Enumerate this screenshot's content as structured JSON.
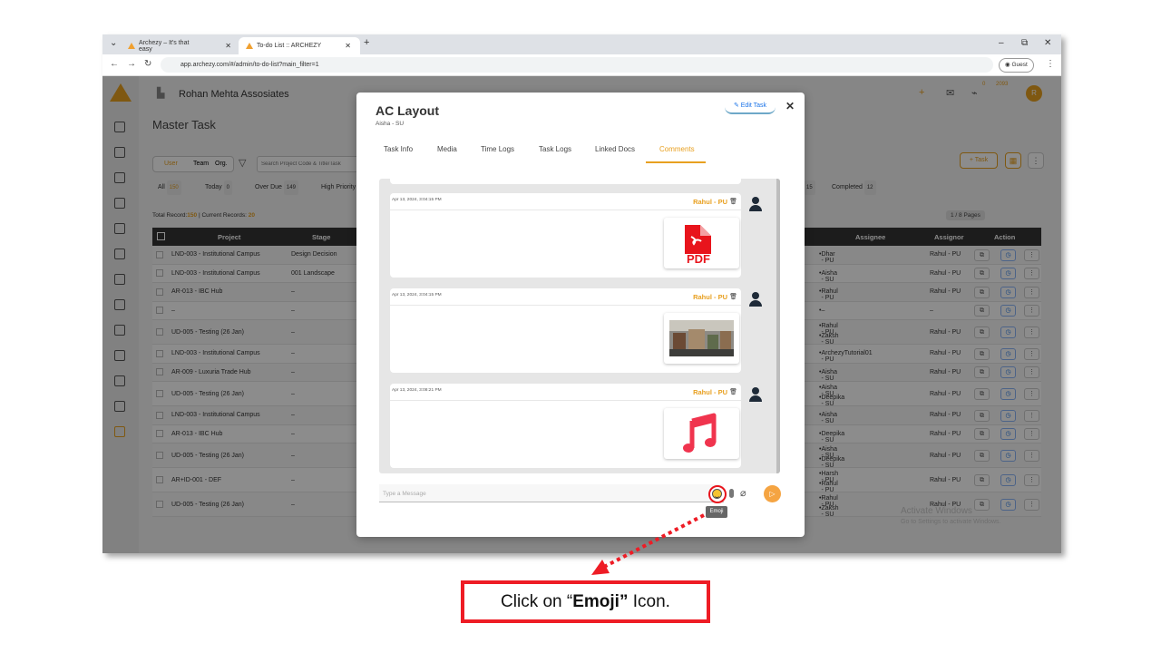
{
  "browser": {
    "tabs": [
      {
        "title": "Archezy – It's that easy",
        "active": false
      },
      {
        "title": "To-do List :: ARCHEZY",
        "active": true
      }
    ],
    "url": "app.archezy.com/#/admin/to-do-list?main_filter=1",
    "profile": "Guest"
  },
  "header": {
    "company": "Rohan Mehta Assosiates",
    "notif_count": "0",
    "task_count": "2093",
    "avatar_letter": "R"
  },
  "page": {
    "title": "Master Task",
    "scope_tabs": [
      "User",
      "Team",
      "Org."
    ],
    "search_placeholder": "Search Project Code & Title/Task",
    "chips": [
      {
        "label": "All",
        "count": "150"
      },
      {
        "label": "Today",
        "count": "0"
      },
      {
        "label": "Over Due",
        "count": "149"
      },
      {
        "label": "High Priority",
        "count": ""
      },
      {
        "label": "",
        "count": "15"
      },
      {
        "label": "Completed",
        "count": "12"
      }
    ],
    "totals_prefix": "Total Record:",
    "total_records": "150",
    "totals_mid": " | Current Records: ",
    "current_records": "20",
    "pages": "1 / 8 Pages",
    "task_button": "+ Task",
    "table": {
      "headers": [
        "Project",
        "Stage",
        "Assignee",
        "Assignor",
        "Action"
      ],
      "rows": [
        {
          "project": "LND-003 - Institutional Campus",
          "stage": "Design Decision",
          "assignee": [
            "Dhar - PU"
          ],
          "assignor": "Rahul - PU"
        },
        {
          "project": "LND-003 - Institutional Campus",
          "stage": "001 Landscape",
          "assignee": [
            "Aisha - SU"
          ],
          "assignor": "Rahul - PU"
        },
        {
          "project": "AR-013 - IBC Hub",
          "stage": "–",
          "assignee": [
            "Rahul - PU"
          ],
          "assignor": "Rahul - PU"
        },
        {
          "project": "–",
          "stage": "–",
          "assignee": [
            "–"
          ],
          "assignor": "–"
        },
        {
          "project": "UD-005 - Testing (26 Jan)",
          "stage": "–",
          "assignee": [
            "Rahul - PU",
            "Zaksh - SU"
          ],
          "assignor": "Rahul - PU"
        },
        {
          "project": "LND-003 - Institutional Campus",
          "stage": "–",
          "assignee": [
            "ArchezyTutorial01 - PU"
          ],
          "assignor": "Rahul - PU"
        },
        {
          "project": "AR-009 - Luxuria Trade Hub",
          "stage": "–",
          "assignee": [
            "Aisha - SU"
          ],
          "assignor": "Rahul - PU"
        },
        {
          "project": "UD-005 - Testing (26 Jan)",
          "stage": "–",
          "assignee": [
            "Aisha - SU",
            "Deepika - SU"
          ],
          "assignor": "Rahul - PU"
        },
        {
          "project": "LND-003 - Institutional Campus",
          "stage": "–",
          "assignee": [
            "Aisha - SU"
          ],
          "assignor": "Rahul - PU"
        },
        {
          "project": "AR-013 - IBC Hub",
          "stage": "–",
          "assignee": [
            "Deepika - SU"
          ],
          "assignor": "Rahul - PU"
        },
        {
          "project": "UD-005 - Testing (26 Jan)",
          "stage": "–",
          "assignee": [
            "Aisha - SU",
            "Deepika - SU"
          ],
          "assignor": "Rahul - PU"
        },
        {
          "project": "AR+ID-001 - DEF",
          "stage": "–",
          "assignee": [
            "Harsh - PU",
            "Rahul - PU"
          ],
          "assignor": "Rahul - PU"
        },
        {
          "project": "UD-005 - Testing (26 Jan)",
          "stage": "–",
          "assignee": [
            "Rahul - PU",
            "Zaksh - SU"
          ],
          "assignor": "Rahul - PU"
        }
      ]
    }
  },
  "modal": {
    "title": "AC Layout",
    "subtitle": "Aisha - SU",
    "edit_label": "Edit Task",
    "tabs": [
      "Task Info",
      "Media",
      "Time Logs",
      "Task Logs",
      "Linked Docs",
      "Comments"
    ],
    "active_tab": "Comments",
    "messages": [
      {
        "time": "Apr 13, 2024, 3:04:15 PM",
        "author": "Rahul - PU",
        "attachment": "pdf",
        "attachment_label": "PDF"
      },
      {
        "time": "Apr 13, 2024, 3:04:15 PM",
        "author": "Rahul - PU",
        "attachment": "image"
      },
      {
        "time": "Apr 13, 2024, 3:08:21 PM",
        "author": "Rahul - PU",
        "attachment": "audio"
      }
    ],
    "input_placeholder": "Type a Message",
    "tooltip": "Emoji"
  },
  "watermark": {
    "line1": "Activate Windows",
    "line2": "Go to Settings to activate Windows."
  },
  "callout": {
    "prefix": "Click on “",
    "bold": "Emoji”",
    "suffix": " Icon."
  },
  "colors": {
    "accent": "#e8a020",
    "highlight": "#ee1c25",
    "pdf": "#e8141c",
    "music": "#f0344e"
  }
}
